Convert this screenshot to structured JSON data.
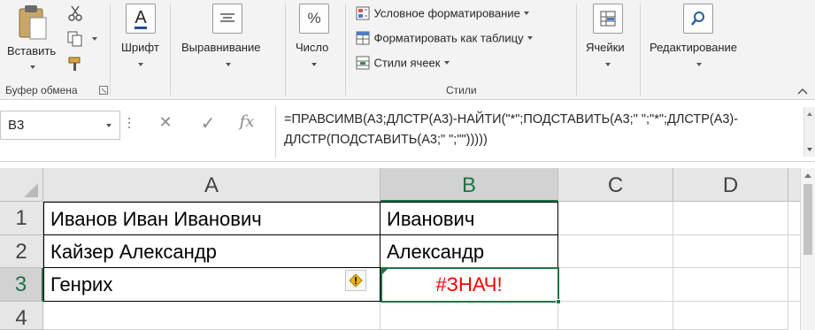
{
  "ribbon": {
    "clipboard": {
      "paste_label": "Вставить",
      "group_label": "Буфер обмена",
      "icons": [
        "paste-icon",
        "cut-icon",
        "copy-icon",
        "format-painter-icon",
        "dialog-launcher-icon"
      ]
    },
    "font": {
      "label": "Шрифт",
      "icon_glyph": "A",
      "accent": "#1f4e9a"
    },
    "alignment": {
      "label": "Выравнивание"
    },
    "number": {
      "label": "Число",
      "icon_glyph": "%"
    },
    "styles": {
      "group_label": "Стили",
      "items": [
        {
          "label": "Условное форматирование",
          "icon": "conditional-formatting-icon"
        },
        {
          "label": "Форматировать как таблицу",
          "icon": "format-as-table-icon"
        },
        {
          "label": "Стили ячеек",
          "icon": "cell-styles-icon"
        }
      ]
    },
    "cells": {
      "label": "Ячейки"
    },
    "editing": {
      "label": "Редактирование"
    }
  },
  "formula_bar": {
    "name_box": "B3",
    "cancel_glyph": "✕",
    "enter_glyph": "✓",
    "fx_glyph": "fx",
    "formula_line1": "=ПРАВСИМВ(A3;ДЛСТР(A3)-НАЙТИ(\"*\";ПОДСТАВИТЬ(A3;\" \";\"*\";ДЛСТР(A3)-",
    "formula_line2": "ДЛСТР(ПОДСТАВИТЬ(A3;\" \";\"\")))))"
  },
  "sheet": {
    "columns": [
      "A",
      "B",
      "C",
      "D"
    ],
    "selected_column": "B",
    "rows": [
      {
        "num": "1",
        "a": "Иванов Иван Иванович",
        "b": "Иванович"
      },
      {
        "num": "2",
        "a": "Кайзер Александр",
        "b": "Александр"
      },
      {
        "num": "3",
        "a": "Генрих",
        "b": "#ЗНАЧ!"
      },
      {
        "num": "4",
        "a": "",
        "b": ""
      }
    ],
    "selected_row": "3",
    "error_color": "#ff0000",
    "selection_color": "#217346"
  }
}
